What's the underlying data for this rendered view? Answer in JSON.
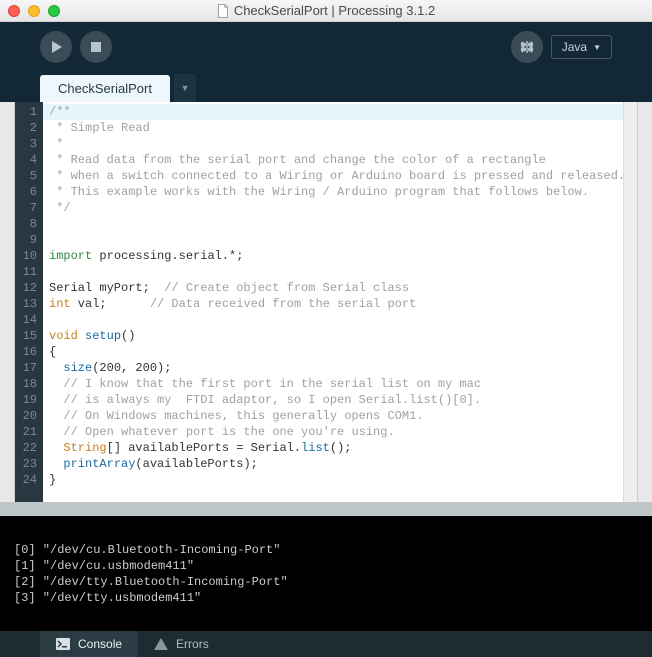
{
  "window": {
    "title": "CheckSerialPort | Processing 3.1.2"
  },
  "toolbar": {
    "mode": "Java"
  },
  "tabs": {
    "active": "CheckSerialPort"
  },
  "code": {
    "lines": [
      {
        "n": 1,
        "seg": [
          {
            "t": "/**",
            "c": "c-com"
          }
        ],
        "hl": true
      },
      {
        "n": 2,
        "seg": [
          {
            "t": " * Simple Read",
            "c": "c-com"
          }
        ]
      },
      {
        "n": 3,
        "seg": [
          {
            "t": " *",
            "c": "c-com"
          }
        ]
      },
      {
        "n": 4,
        "seg": [
          {
            "t": " * Read data from the serial port and change the color of a rectangle",
            "c": "c-com"
          }
        ]
      },
      {
        "n": 5,
        "seg": [
          {
            "t": " * when a switch connected to a Wiring or Arduino board is pressed and released.",
            "c": "c-com"
          }
        ]
      },
      {
        "n": 6,
        "seg": [
          {
            "t": " * This example works with the Wiring / Arduino program that follows below.",
            "c": "c-com"
          }
        ]
      },
      {
        "n": 7,
        "seg": [
          {
            "t": " */",
            "c": "c-com"
          }
        ]
      },
      {
        "n": 8,
        "seg": [
          {
            "t": "",
            "c": ""
          }
        ]
      },
      {
        "n": 9,
        "seg": [
          {
            "t": "",
            "c": ""
          }
        ]
      },
      {
        "n": 10,
        "seg": [
          {
            "t": "import",
            "c": "c-kw"
          },
          {
            "t": " processing.serial.*;",
            "c": ""
          }
        ]
      },
      {
        "n": 11,
        "seg": [
          {
            "t": "",
            "c": ""
          }
        ]
      },
      {
        "n": 12,
        "seg": [
          {
            "t": "Serial myPort;  ",
            "c": ""
          },
          {
            "t": "// Create object from Serial class",
            "c": "c-com"
          }
        ]
      },
      {
        "n": 13,
        "seg": [
          {
            "t": "int",
            "c": "c-type"
          },
          {
            "t": " val;      ",
            "c": ""
          },
          {
            "t": "// Data received from the serial port",
            "c": "c-com"
          }
        ]
      },
      {
        "n": 14,
        "seg": [
          {
            "t": "",
            "c": ""
          }
        ]
      },
      {
        "n": 15,
        "seg": [
          {
            "t": "void",
            "c": "c-type"
          },
          {
            "t": " ",
            "c": ""
          },
          {
            "t": "setup",
            "c": "c-fn2"
          },
          {
            "t": "()",
            "c": ""
          }
        ]
      },
      {
        "n": 16,
        "seg": [
          {
            "t": "{",
            "c": ""
          }
        ]
      },
      {
        "n": 17,
        "seg": [
          {
            "t": "  ",
            "c": ""
          },
          {
            "t": "size",
            "c": "c-fn"
          },
          {
            "t": "(200, 200);",
            "c": ""
          }
        ]
      },
      {
        "n": 18,
        "seg": [
          {
            "t": "  ",
            "c": ""
          },
          {
            "t": "// I know that the first port in the serial list on my mac",
            "c": "c-com"
          }
        ]
      },
      {
        "n": 19,
        "seg": [
          {
            "t": "  ",
            "c": ""
          },
          {
            "t": "// is always my  FTDI adaptor, so I open Serial.list()[0].",
            "c": "c-com"
          }
        ]
      },
      {
        "n": 20,
        "seg": [
          {
            "t": "  ",
            "c": ""
          },
          {
            "t": "// On Windows machines, this generally opens COM1.",
            "c": "c-com"
          }
        ]
      },
      {
        "n": 21,
        "seg": [
          {
            "t": "  ",
            "c": ""
          },
          {
            "t": "// Open whatever port is the one you're using.",
            "c": "c-com"
          }
        ]
      },
      {
        "n": 22,
        "seg": [
          {
            "t": "  ",
            "c": ""
          },
          {
            "t": "String",
            "c": "c-type"
          },
          {
            "t": "[] availablePorts = Serial.",
            "c": ""
          },
          {
            "t": "list",
            "c": "c-fn"
          },
          {
            "t": "();",
            "c": ""
          }
        ]
      },
      {
        "n": 23,
        "seg": [
          {
            "t": "  ",
            "c": ""
          },
          {
            "t": "printArray",
            "c": "c-fn"
          },
          {
            "t": "(availablePorts);",
            "c": ""
          }
        ]
      },
      {
        "n": 24,
        "seg": [
          {
            "t": "}",
            "c": ""
          }
        ]
      }
    ]
  },
  "console": {
    "lines": [
      "[0] \"/dev/cu.Bluetooth-Incoming-Port\"",
      "[1] \"/dev/cu.usbmodem411\"",
      "[2] \"/dev/tty.Bluetooth-Incoming-Port\"",
      "[3] \"/dev/tty.usbmodem411\""
    ]
  },
  "bottomTabs": {
    "console": "Console",
    "errors": "Errors"
  }
}
